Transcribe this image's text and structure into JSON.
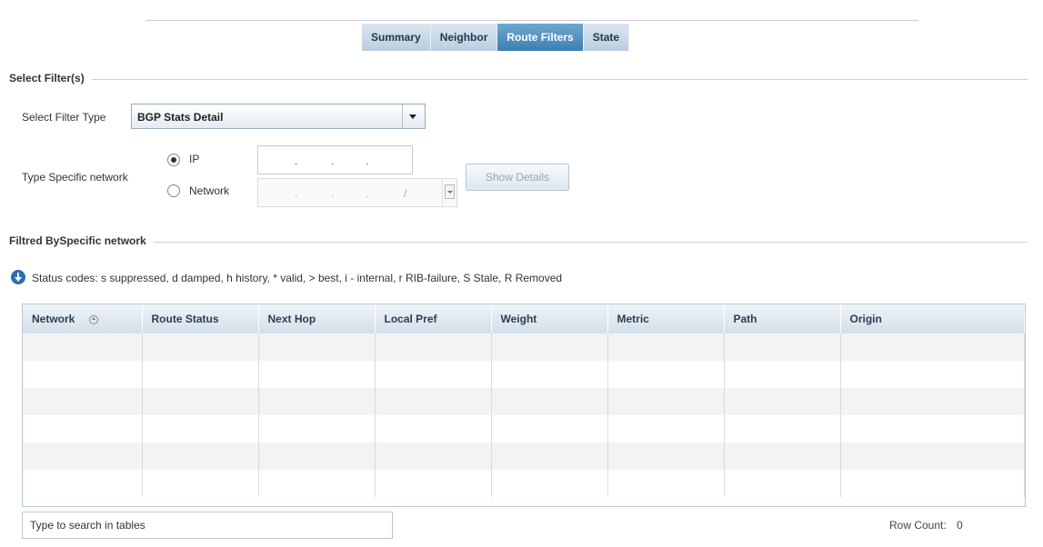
{
  "tabs": [
    {
      "label": "Summary",
      "active": false
    },
    {
      "label": "Neighbor",
      "active": false
    },
    {
      "label": "Route Filters",
      "active": true
    },
    {
      "label": "State",
      "active": false
    }
  ],
  "select_filters": {
    "section_title": "Select Filter(s)",
    "filter_type_label": "Select Filter Type",
    "filter_type_value": "BGP Stats Detail",
    "type_specific_label": "Type Specific network",
    "ip_radio_label": "IP",
    "network_radio_label": "Network",
    "selected_radio": "IP",
    "show_details_label": "Show Details"
  },
  "filtered": {
    "section_title": "Filtred BySpecific network",
    "status_codes": "Status codes: s suppressed, d damped, h history, * valid, > best, i - internal, r RIB-failure, S Stale, R Removed"
  },
  "table": {
    "columns": [
      "Network",
      "Route Status",
      "Next Hop",
      "Local Pref",
      "Weight",
      "Metric",
      "Path",
      "Origin"
    ],
    "empty_rows": 6
  },
  "footer": {
    "search_placeholder": "Type to search in tables",
    "row_count_label": "Row Count:",
    "row_count_value": "0"
  },
  "colors": {
    "active_tab": "#3d7fb2",
    "tab": "#c3d6e6",
    "info_icon": "#2f6fb0"
  }
}
